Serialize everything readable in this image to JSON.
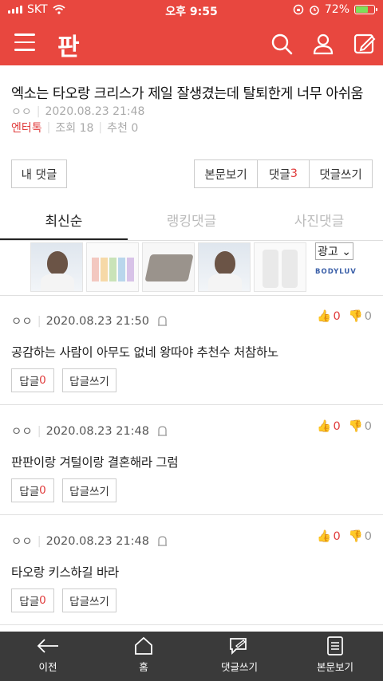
{
  "status": {
    "carrier": "SKT",
    "time": "오후 9:55",
    "battery": "72%",
    "battery_level": 0.72
  },
  "header": {
    "logo": "판"
  },
  "article": {
    "title": "엑소는 타오랑 크리스가 제일 잘생겼는데 탈퇴한게 너무 아쉬움",
    "author": "ㅇㅇ",
    "date": "2020.08.23 21:48",
    "category": "엔터톡",
    "views": "조회 18",
    "likes": "추천 0"
  },
  "buttons": {
    "my_comments": "내 댓글",
    "view_post": "본문보기",
    "comments_label": "댓글",
    "comments_count": "3",
    "write_comment": "댓글쓰기"
  },
  "tabs": [
    "최신순",
    "랭킹댓글",
    "사진댓글"
  ],
  "ad": {
    "label": "광고",
    "brand": "BODYLUV"
  },
  "comments": [
    {
      "author": "ㅇㅇ",
      "date": "2020.08.23 21:50",
      "up": "0",
      "down": "0",
      "text": "공감하는 사람이 아무도 없네 왕따야 추천수 처참하노",
      "reply_label": "답글",
      "reply_count": "0",
      "write_reply": "답글쓰기"
    },
    {
      "author": "ㅇㅇ",
      "date": "2020.08.23 21:48",
      "up": "0",
      "down": "0",
      "text": "판판이랑 겨털이랑 결혼해라 그럼",
      "reply_label": "답글",
      "reply_count": "0",
      "write_reply": "답글쓰기"
    },
    {
      "author": "ㅇㅇ",
      "date": "2020.08.23 21:48",
      "up": "0",
      "down": "0",
      "text": "타오랑 키스하길 바라",
      "reply_label": "답글",
      "reply_count": "0",
      "write_reply": "답글쓰기"
    }
  ],
  "bottom_nav": {
    "prev": "이전",
    "home": "홈",
    "write": "댓글쓰기",
    "view": "본문보기"
  }
}
